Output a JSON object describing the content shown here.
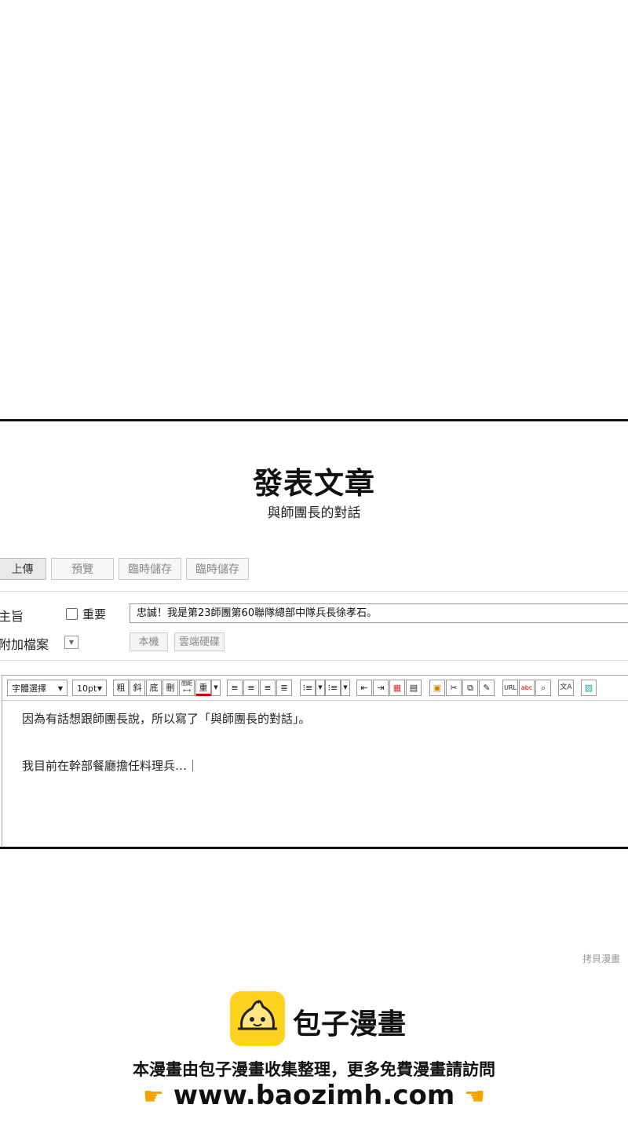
{
  "page": {
    "title": "發表文章",
    "subtitle": "與師團長的對話"
  },
  "actions": {
    "upload": "上傳",
    "preview": "預覽",
    "temp_save_1": "臨時儲存",
    "temp_save_2": "臨時儲存"
  },
  "form": {
    "subject_label": "主旨",
    "important_label": "重要",
    "important_checked": false,
    "subject_value": "忠誠！我是第23師團第60聯隊總部中隊兵長徐孝石。",
    "attachment_label": "附加檔案",
    "local_button": "本機",
    "cloud_button": "雲端硬碟"
  },
  "toolbar": {
    "font_select": "字體選擇",
    "size_select": "10pt",
    "bold": "粗",
    "italic": "斜",
    "underline": "底",
    "strike": "刪",
    "spacing": "間距",
    "color": "重",
    "url": "URL",
    "icons": [
      "align-left-icon",
      "align-center-icon",
      "align-right-icon",
      "align-justify-icon",
      "bullet-list-icon",
      "numbered-list-icon",
      "outdent-icon",
      "indent-icon",
      "table-icon",
      "box-icon",
      "paste-icon",
      "cut-icon",
      "copy-icon",
      "format-icon",
      "spellcheck-icon",
      "search-icon",
      "translate-icon",
      "image-icon"
    ]
  },
  "editor": {
    "line1": "因為有話想跟師團長說，所以寫了「與師團長的對話」。",
    "line2": "我目前在幹部餐廳擔任料理兵…｜"
  },
  "footer": {
    "watermark": "拷貝漫畫",
    "brand": "包子漫畫",
    "promo": "本漫畫由包子漫畫收集整理，更多免費漫畫請訪問",
    "url": "www.baozimh.com",
    "brand_color": "#FFD21F"
  }
}
